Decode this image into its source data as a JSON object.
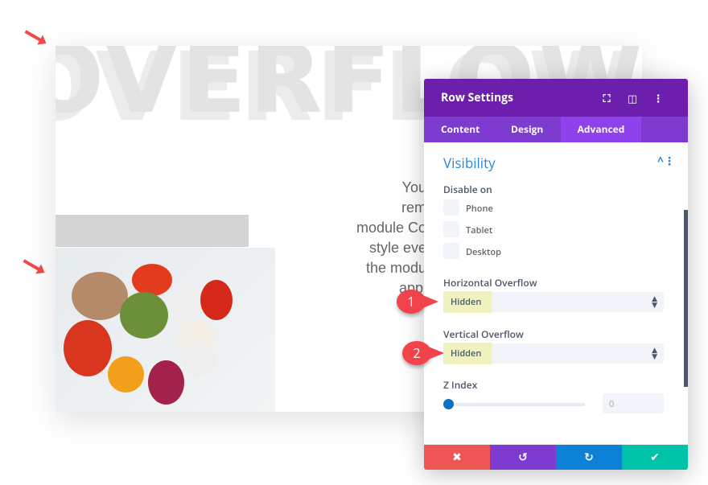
{
  "canvas": {
    "heading": "OVERFLOW",
    "paragraph_lines": [
      "You",
      "rem",
      "module Co",
      "style eve",
      "the modu",
      "appl"
    ]
  },
  "panel": {
    "title": "Row Settings",
    "icons": [
      "focus-icon",
      "split-view-icon",
      "more-icon"
    ],
    "tabs": [
      {
        "label": "Content"
      },
      {
        "label": "Design"
      },
      {
        "label": "Advanced",
        "active": true
      }
    ],
    "section": "Visibility",
    "disable_on_label": "Disable on",
    "disable_options": [
      {
        "label": "Phone",
        "checked": false
      },
      {
        "label": "Tablet",
        "checked": false
      },
      {
        "label": "Desktop",
        "checked": false
      }
    ],
    "horizontal_overflow": {
      "label": "Horizontal Overflow",
      "value": "Hidden"
    },
    "vertical_overflow": {
      "label": "Vertical Overflow",
      "value": "Hidden"
    },
    "z_index": {
      "label": "Z Index",
      "value": "0"
    },
    "footer": {
      "cancel": "✖",
      "undo": "↺",
      "redo": "↻",
      "save": "✔"
    }
  },
  "callouts": [
    "1",
    "2"
  ],
  "colors": {
    "header": "#6c1fad",
    "tabs": "#7e3bd0",
    "tab_active": "#8f42ec",
    "accent": "#2b87da",
    "cancel": "#ef5555",
    "undo": "#7e3bd0",
    "redo": "#0c81d6",
    "save": "#00c2a7",
    "callout": "#f0434a",
    "highlight": "#eff2c0"
  }
}
